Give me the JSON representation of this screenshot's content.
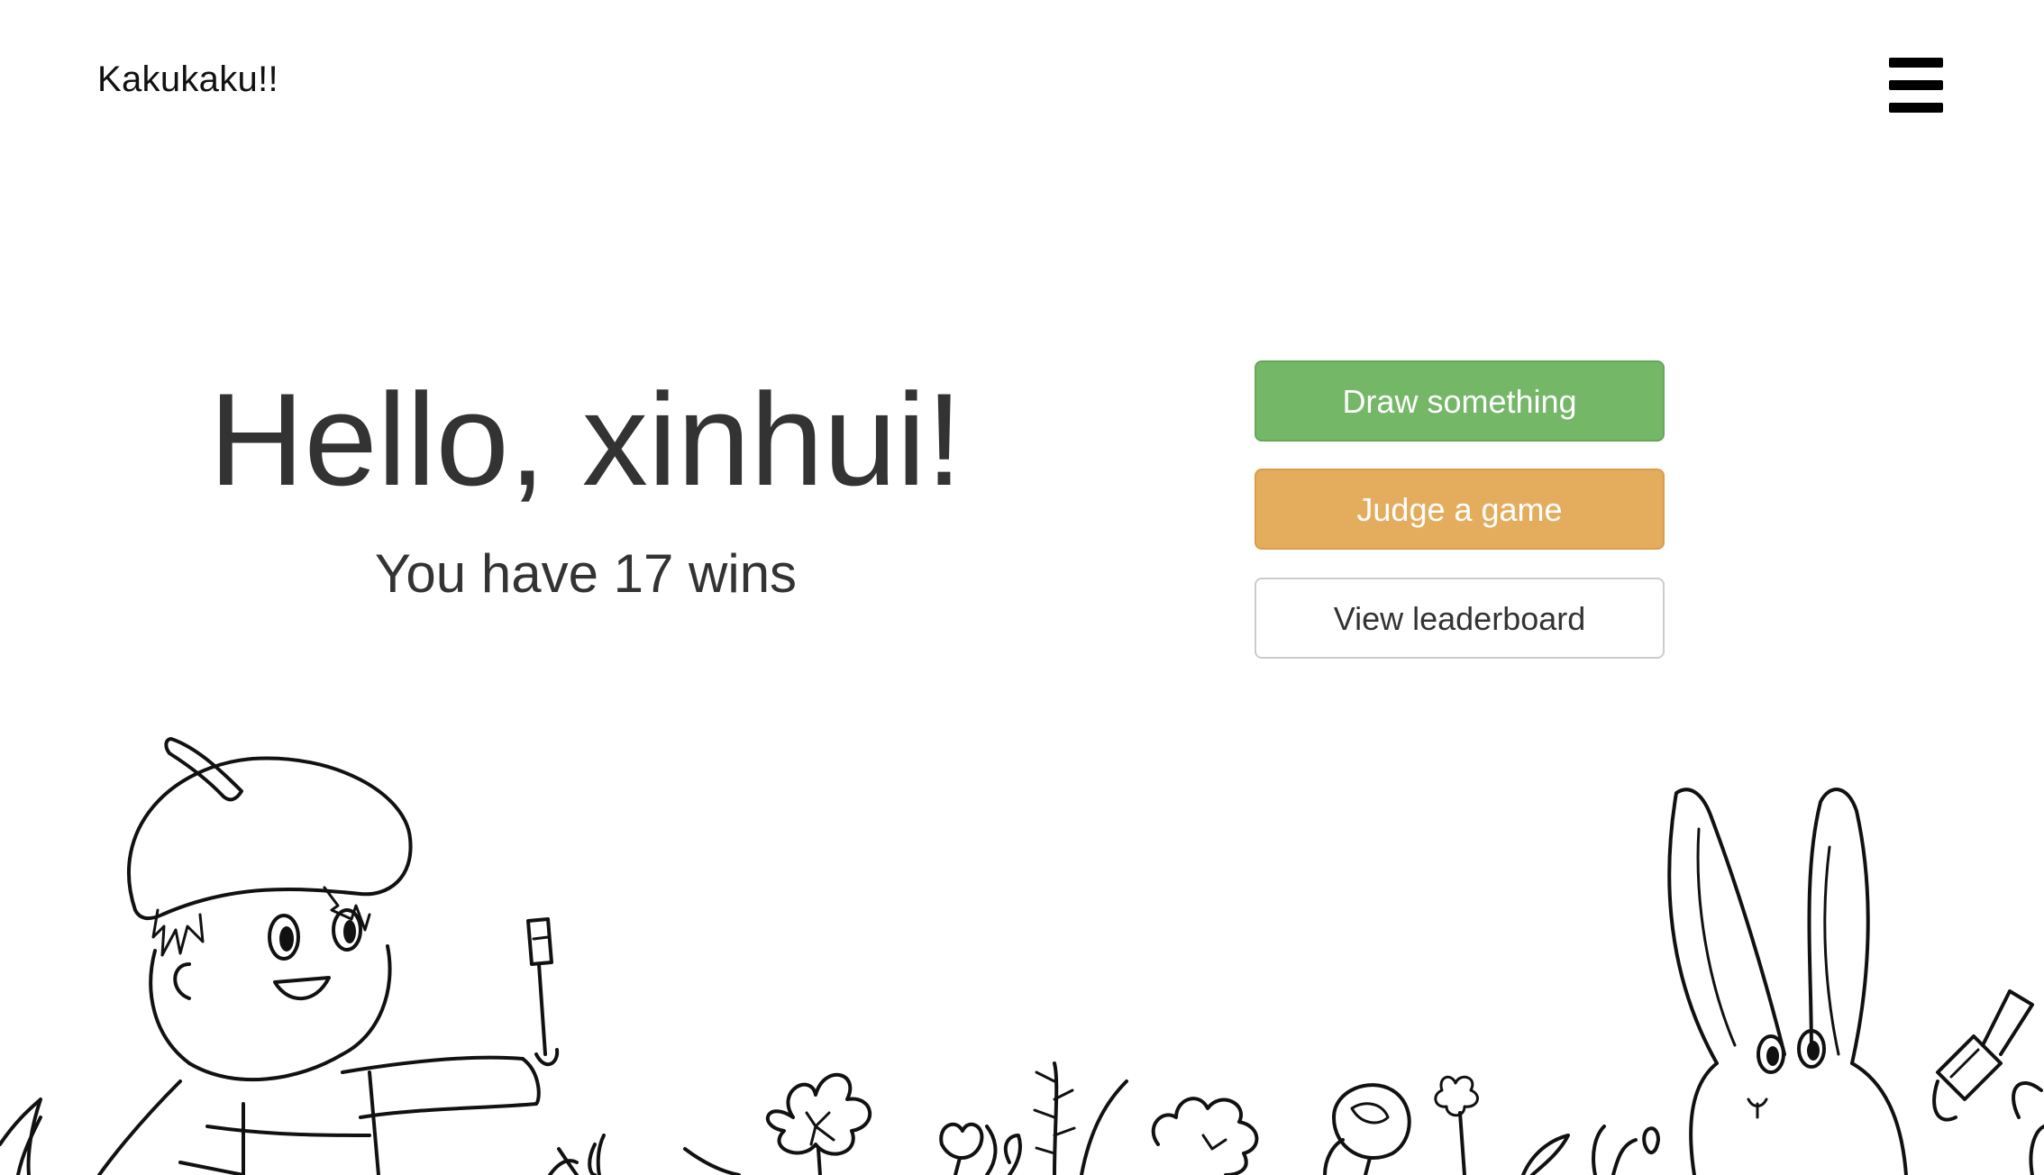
{
  "header": {
    "brand": "Kakukaku!!",
    "menu_icon": "hamburger-menu-icon"
  },
  "main": {
    "greeting": "Hello, xinhui!",
    "wins_text": "You have 17 wins"
  },
  "actions": {
    "draw_label": "Draw something",
    "judge_label": "Judge a game",
    "leaderboard_label": "View leaderboard"
  },
  "colors": {
    "draw_button": "#74b767",
    "judge_button": "#e4ad5e",
    "leaderboard_button": "#ffffff",
    "text": "#333333"
  },
  "illustration": {
    "icons": [
      "painter-child-with-beret-icon",
      "bunny-with-brush-icon",
      "flower-field-icon"
    ]
  }
}
